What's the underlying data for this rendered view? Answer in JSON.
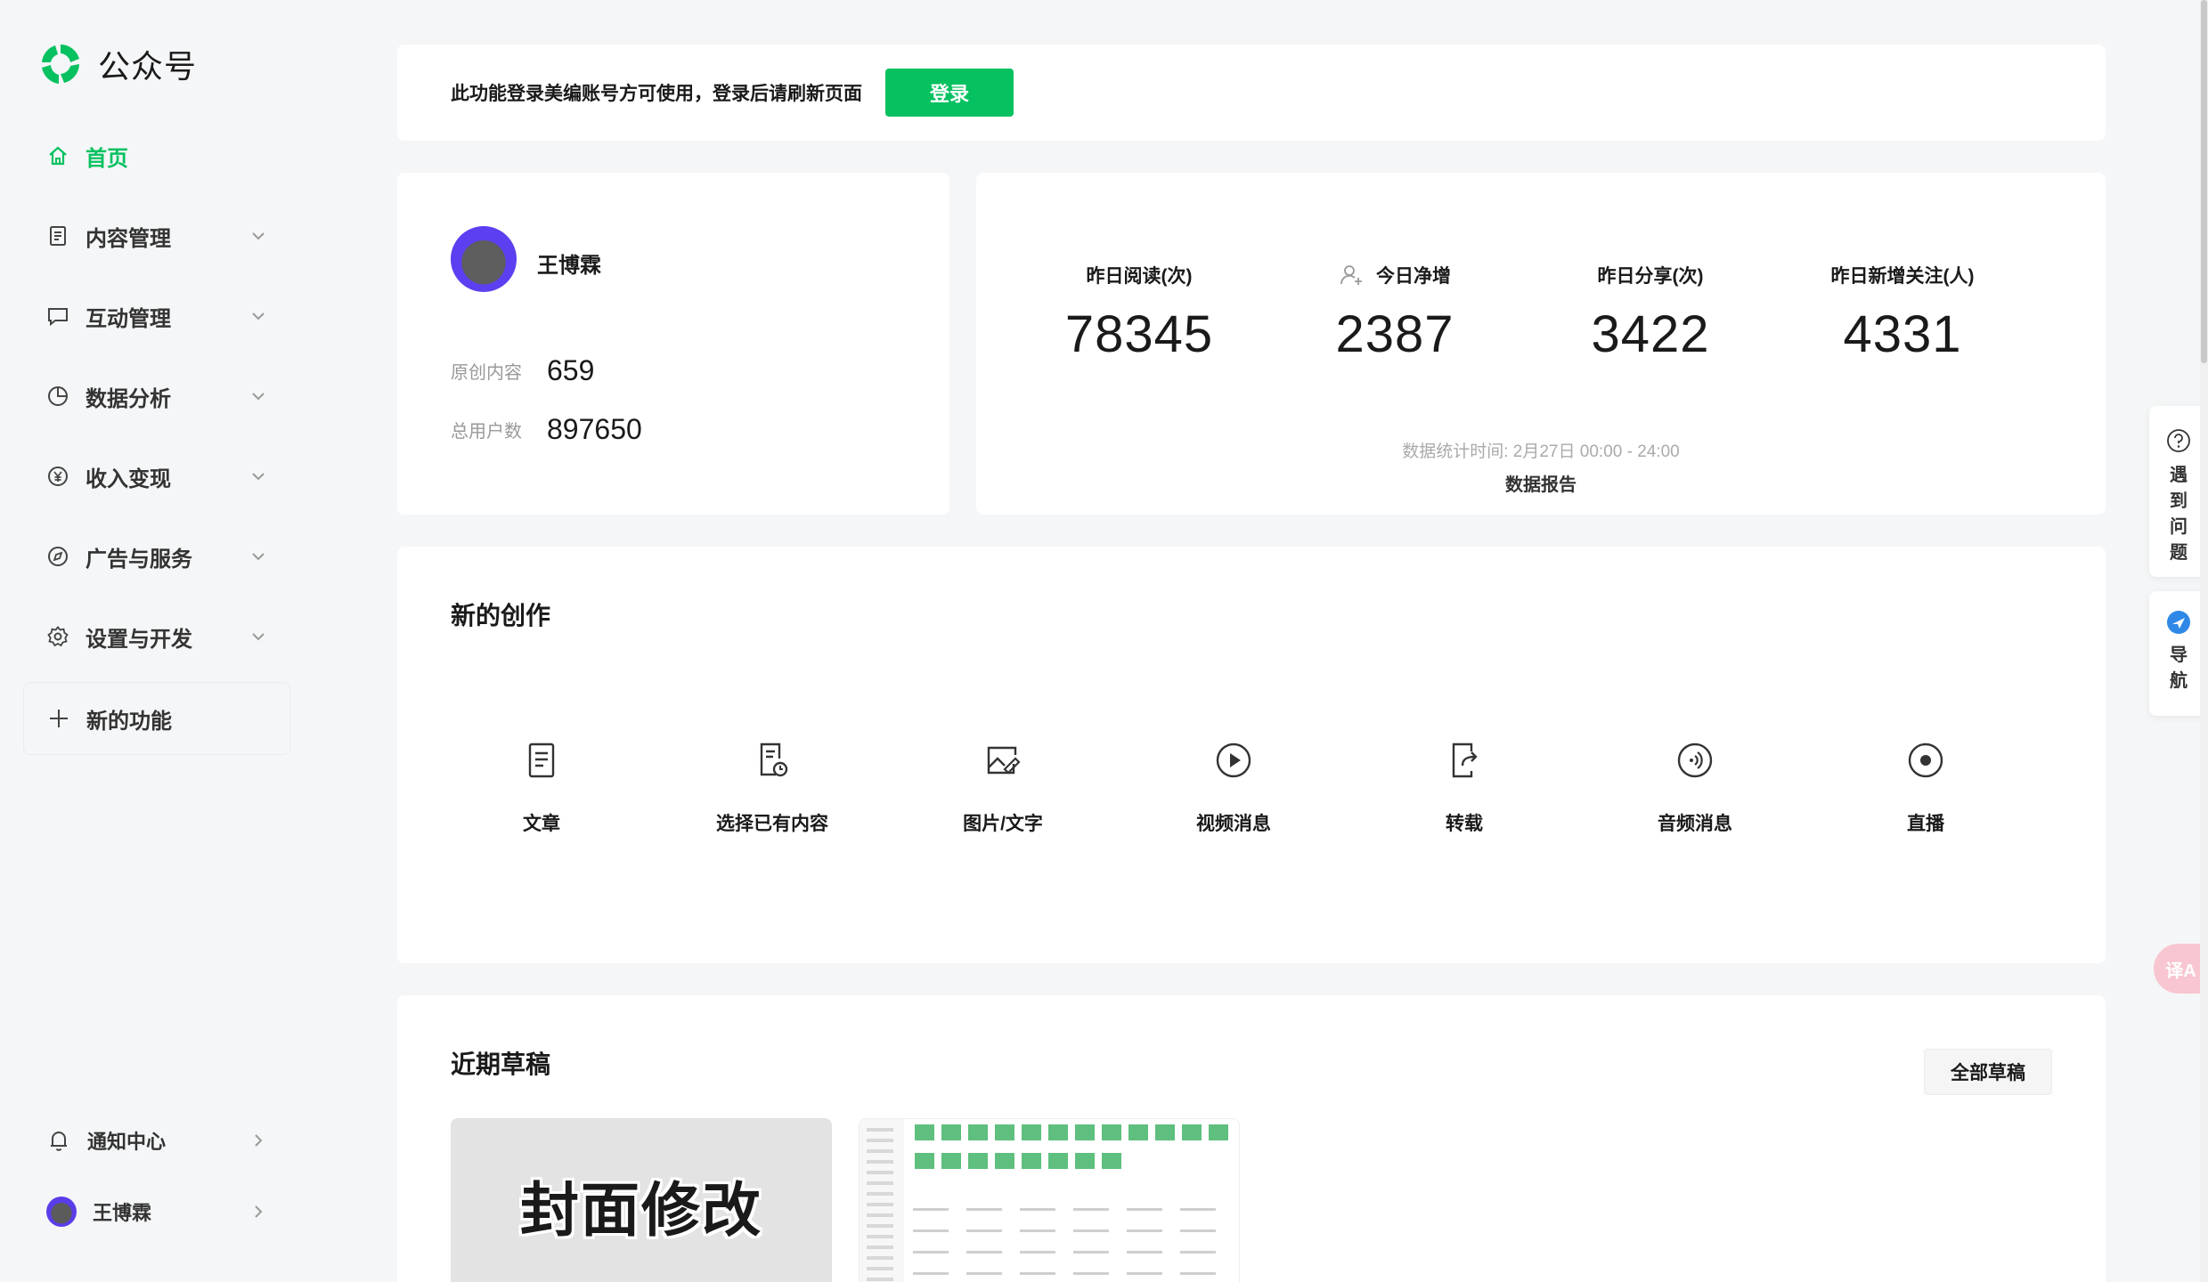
{
  "app": {
    "title": "公众号",
    "brand_color": "#07c160"
  },
  "sidebar": {
    "items": [
      {
        "label": "首页",
        "icon": "home-icon",
        "active": true
      },
      {
        "label": "内容管理",
        "icon": "document-icon"
      },
      {
        "label": "互动管理",
        "icon": "chat-icon"
      },
      {
        "label": "数据分析",
        "icon": "pie-chart-icon"
      },
      {
        "label": "收入变现",
        "icon": "yen-icon"
      },
      {
        "label": "广告与服务",
        "icon": "compass-icon"
      },
      {
        "label": "设置与开发",
        "icon": "gear-icon"
      }
    ],
    "new_feature": "新的功能",
    "notification_center": "通知中心",
    "user_name": "王博霖"
  },
  "login_banner": {
    "message": "此功能登录美编账号方可使用，登录后请刷新页面",
    "button": "登录"
  },
  "profile": {
    "name": "王博霖",
    "original_label": "原创内容",
    "original_value": "659",
    "users_label": "总用户数",
    "users_value": "897650"
  },
  "metrics": {
    "items": [
      {
        "label": "昨日阅读(次)",
        "value": "78345"
      },
      {
        "label": "今日净增",
        "value": "2387",
        "icon": "user-add-icon"
      },
      {
        "label": "昨日分享(次)",
        "value": "3422"
      },
      {
        "label": "昨日新增关注(人)",
        "value": "4331"
      }
    ],
    "stat_time": "数据统计时间: 2月27日 00:00 - 24:00",
    "report_link": "数据报告"
  },
  "create": {
    "title": "新的创作",
    "items": [
      {
        "label": "文章",
        "icon": "article-icon"
      },
      {
        "label": "选择已有内容",
        "icon": "existing-content-icon"
      },
      {
        "label": "图片/文字",
        "icon": "image-text-icon"
      },
      {
        "label": "视频消息",
        "icon": "video-icon"
      },
      {
        "label": "转载",
        "icon": "repost-icon"
      },
      {
        "label": "音频消息",
        "icon": "audio-icon"
      },
      {
        "label": "直播",
        "icon": "live-icon"
      }
    ]
  },
  "drafts": {
    "title": "近期草稿",
    "all_button": "全部草稿",
    "first_cover_text": "封面修改"
  },
  "float_tools": {
    "help_label": "遇到问题",
    "nav_label": "导航",
    "translate_label": "译A"
  }
}
